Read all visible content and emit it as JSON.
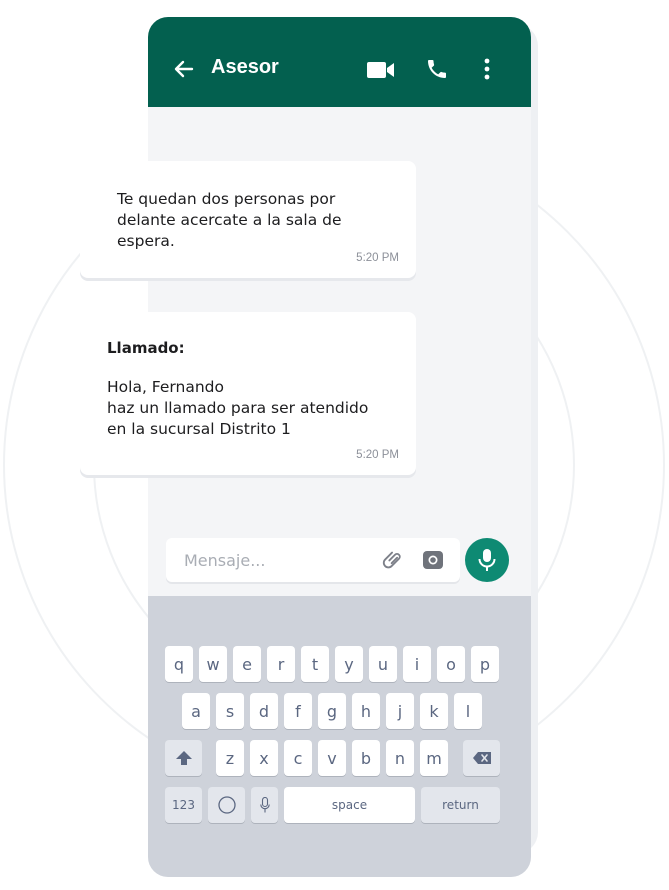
{
  "header": {
    "title": "Asesor",
    "back_icon": "arrow-left-icon",
    "video_icon": "video-camera-icon",
    "call_icon": "phone-icon",
    "more_icon": "more-vertical-icon",
    "color": "#03604f"
  },
  "messages": [
    {
      "lines": [
        "Te quedan dos personas por",
        "delante acercate a la sala de",
        "espera."
      ],
      "time": "5:20 PM"
    },
    {
      "heading": "Llamado:",
      "lines": [
        "Hola, Fernando",
        "haz un llamado para ser atendido",
        "en la sucursal Distrito 1"
      ],
      "time": "5:20 PM"
    }
  ],
  "composer": {
    "placeholder": "Mensaje...",
    "attach_icon": "paperclip-icon",
    "camera_icon": "camera-icon",
    "mic_icon": "microphone-icon",
    "mic_color": "#0e8a73"
  },
  "keyboard": {
    "row1": [
      "q",
      "w",
      "e",
      "r",
      "t",
      "y",
      "u",
      "i",
      "o",
      "p"
    ],
    "row2": [
      "a",
      "s",
      "d",
      "f",
      "g",
      "h",
      "j",
      "k",
      "l"
    ],
    "row3": [
      "z",
      "x",
      "c",
      "v",
      "b",
      "n",
      "m"
    ],
    "shift_icon": "shift-icon",
    "backspace_icon": "backspace-icon",
    "numbers_label": "123",
    "globe_icon": "globe-icon",
    "dictation_icon": "microphone-icon",
    "space_label": "space",
    "return_label": "return"
  }
}
